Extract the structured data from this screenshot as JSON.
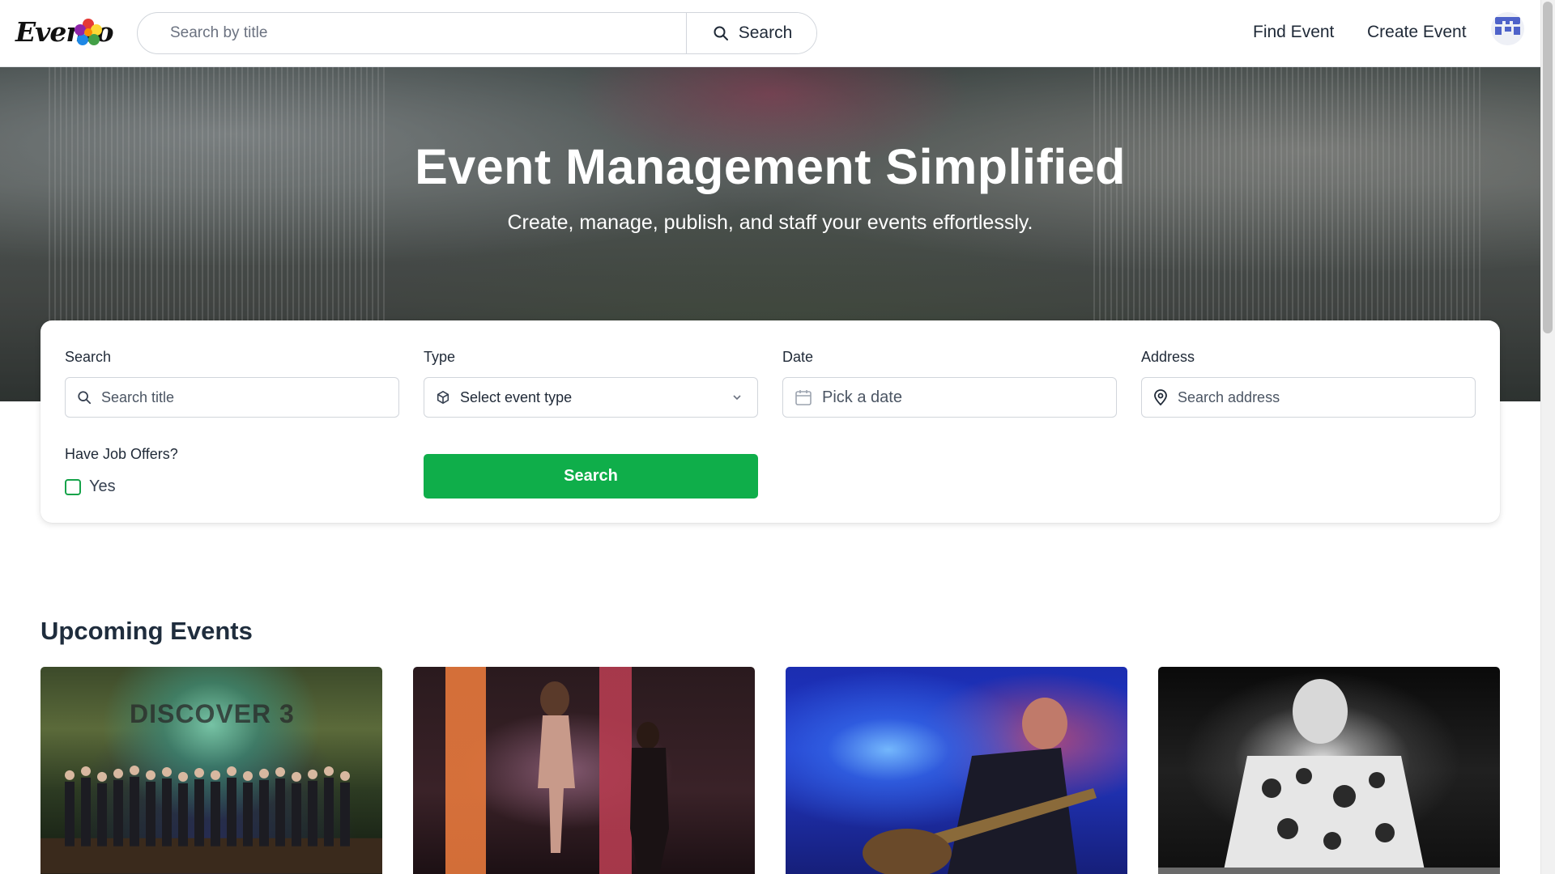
{
  "header": {
    "logo_text": "Evento",
    "search_placeholder": "Search by title",
    "search_button_label": "Search",
    "nav": {
      "find_event": "Find Event",
      "create_event": "Create Event"
    }
  },
  "hero": {
    "title": "Event Management Simplified",
    "subtitle": "Create, manage, publish, and staff your events effortlessly."
  },
  "filters": {
    "search": {
      "label": "Search",
      "placeholder": "Search title"
    },
    "type": {
      "label": "Type",
      "value": "Select event type"
    },
    "date": {
      "label": "Date",
      "value": "Pick a date"
    },
    "address": {
      "label": "Address",
      "placeholder": "Search address"
    },
    "job_offers": {
      "label": "Have Job Offers?",
      "option": "Yes",
      "checked": false
    },
    "submit_label": "Search"
  },
  "upcoming": {
    "title": "Upcoming Events",
    "cards": [
      {
        "image_text": "DISCOVER 3"
      },
      {
        "image_text": ""
      },
      {
        "image_text": ""
      },
      {
        "image_text": ""
      }
    ]
  },
  "colors": {
    "primary_green": "#0fae4a",
    "checkbox_border": "#16a34a",
    "text_dark": "#1f2937"
  },
  "icons": [
    "search-icon",
    "cube-icon",
    "chevron-down-icon",
    "calendar-icon",
    "map-pin-icon",
    "avatar-icon"
  ]
}
